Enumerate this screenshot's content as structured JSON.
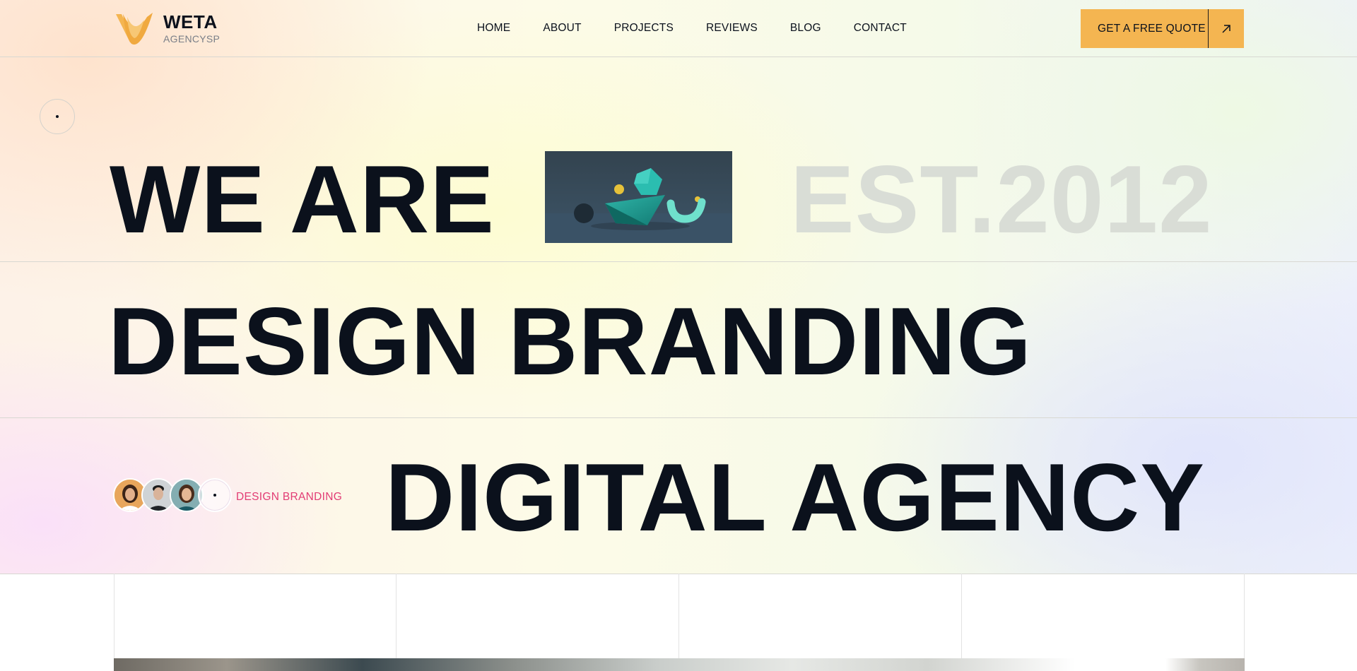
{
  "brand": {
    "name": "WETA",
    "tagline": "AGENCYSP",
    "accent_color": "#f4b551",
    "highlight_color": "#e23c74"
  },
  "nav": {
    "items": [
      {
        "label": "HOME"
      },
      {
        "label": "ABOUT"
      },
      {
        "label": "PROJECTS"
      },
      {
        "label": "REVIEWS"
      },
      {
        "label": "BLOG"
      },
      {
        "label": "CONTACT"
      }
    ]
  },
  "header": {
    "cta_label": "GET A FREE QUOTE",
    "cta_icon": "arrow-up-right-icon"
  },
  "hero": {
    "line1": "WE ARE",
    "established": "EST.2012",
    "line2": "DESIGN BRANDING",
    "line3": "DIGITAL AGENCY",
    "tag": "DESIGN BRANDING"
  }
}
